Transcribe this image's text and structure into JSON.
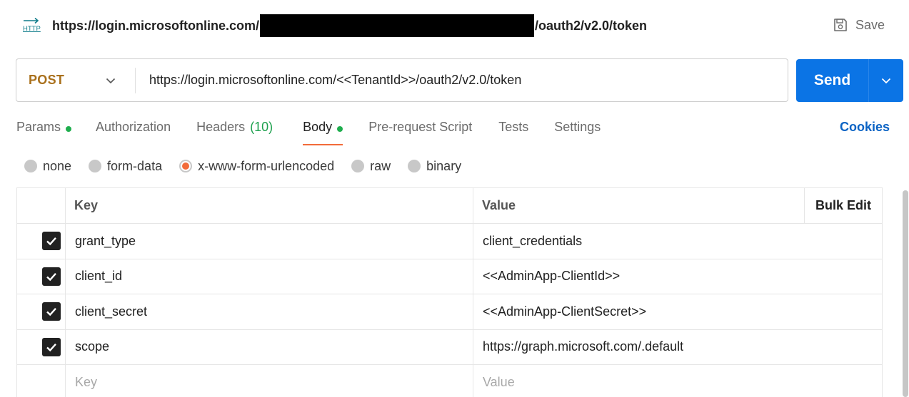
{
  "titlebar": {
    "icon": "http-icon",
    "icon_label": "HTTP",
    "title_prefix": "https://login.microsoftonline.com/",
    "title_suffix": "/oauth2/v2.0/token",
    "save_label": "Save"
  },
  "request": {
    "method": "POST",
    "url": "https://login.microsoftonline.com/<<TenantId>>/oauth2/v2.0/token",
    "send_label": "Send"
  },
  "tabs": [
    {
      "label": "Params",
      "dot": true
    },
    {
      "label": "Authorization"
    },
    {
      "label": "Headers",
      "count": "(10)"
    },
    {
      "label": "Body",
      "dot": true,
      "active": true
    },
    {
      "label": "Pre-request Script"
    },
    {
      "label": "Tests"
    },
    {
      "label": "Settings"
    }
  ],
  "cookies_label": "Cookies",
  "body_types": [
    {
      "label": "none",
      "selected": false
    },
    {
      "label": "form-data",
      "selected": false
    },
    {
      "label": "x-www-form-urlencoded",
      "selected": true
    },
    {
      "label": "raw",
      "selected": false
    },
    {
      "label": "binary",
      "selected": false
    }
  ],
  "table": {
    "headers": {
      "key": "Key",
      "value": "Value",
      "bulk_edit": "Bulk Edit"
    },
    "rows": [
      {
        "checked": true,
        "key": "grant_type",
        "value": "client_credentials"
      },
      {
        "checked": true,
        "key": "client_id",
        "value": "<<AdminApp-ClientId>>"
      },
      {
        "checked": true,
        "key": "client_secret",
        "value": "<<AdminApp-ClientSecret>>"
      },
      {
        "checked": true,
        "key": "scope",
        "value": "https://graph.microsoft.com/.default"
      }
    ],
    "placeholder": {
      "key": "Key",
      "value": "Value"
    }
  },
  "colors": {
    "accent_orange": "#f26b3a",
    "send_blue": "#0b74e5",
    "method_post": "#a9701c",
    "dot_green": "#1fae4e",
    "cookies_blue": "#0b63c4"
  }
}
